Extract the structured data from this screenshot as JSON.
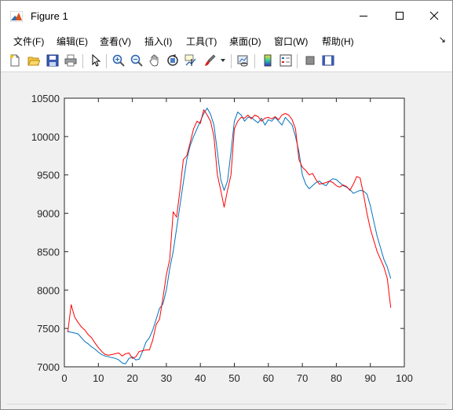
{
  "window": {
    "title": "Figure 1",
    "controls": {
      "minimize": "minimize",
      "maximize": "maximize",
      "close": "close"
    }
  },
  "menu": {
    "items": [
      "文件(F)",
      "编辑(E)",
      "查看(V)",
      "插入(I)",
      "工具(T)",
      "桌面(D)",
      "窗口(W)",
      "帮助(H)"
    ]
  },
  "toolbar": {
    "icons": [
      "new-figure-icon",
      "open-file-icon",
      "save-icon",
      "print-icon",
      "select-arrow-icon",
      "zoom-in-icon",
      "zoom-out-icon",
      "pan-hand-icon",
      "rotate-3d-icon",
      "data-cursor-icon",
      "brush-icon",
      "brush-dropdown-icon",
      "link-plot-icon",
      "colorbar-icon",
      "legend-icon",
      "hide-plot-tools-icon",
      "show-plot-tools-icon"
    ]
  },
  "colors": {
    "series1": "#0072BD",
    "series2": "#FF0000",
    "axes_background": "#ffffff",
    "figure_background": "#f0f0f0"
  },
  "chart_data": {
    "type": "line",
    "title": "",
    "xlabel": "",
    "ylabel": "",
    "xlim": [
      0,
      100
    ],
    "ylim": [
      7000,
      10500
    ],
    "xticks": [
      0,
      10,
      20,
      30,
      40,
      50,
      60,
      70,
      80,
      90,
      100
    ],
    "yticks": [
      7000,
      7500,
      8000,
      8500,
      9000,
      9500,
      10000,
      10500
    ],
    "grid": false,
    "legend": "none",
    "series": [
      {
        "color": "#0072BD",
        "x": [
          1,
          2,
          3,
          4,
          5,
          6,
          7,
          8,
          9,
          10,
          11,
          12,
          13,
          14,
          15,
          16,
          17,
          18,
          19,
          20,
          21,
          22,
          23,
          24,
          25,
          26,
          27,
          28,
          29,
          30,
          31,
          32,
          33,
          34,
          35,
          36,
          37,
          38,
          39,
          40,
          41,
          42,
          43,
          44,
          45,
          46,
          47,
          48,
          49,
          50,
          51,
          52,
          53,
          54,
          55,
          56,
          57,
          58,
          59,
          60,
          61,
          62,
          63,
          64,
          65,
          66,
          67,
          68,
          69,
          70,
          71,
          72,
          73,
          74,
          75,
          76,
          77,
          78,
          79,
          80,
          81,
          82,
          83,
          84,
          85,
          86,
          87,
          88,
          89,
          90,
          91,
          92,
          93,
          94,
          95,
          96
        ],
        "y": [
          7460,
          7450,
          7440,
          7430,
          7380,
          7330,
          7300,
          7260,
          7230,
          7190,
          7160,
          7140,
          7130,
          7120,
          7110,
          7090,
          7050,
          7040,
          7110,
          7130,
          7090,
          7100,
          7200,
          7320,
          7380,
          7480,
          7620,
          7760,
          7820,
          8000,
          8280,
          8500,
          8800,
          9100,
          9400,
          9700,
          9880,
          10000,
          10100,
          10200,
          10300,
          10370,
          10290,
          10150,
          9800,
          9440,
          9300,
          9420,
          9800,
          10200,
          10320,
          10280,
          10200,
          10250,
          10250,
          10210,
          10180,
          10240,
          10150,
          10220,
          10200,
          10250,
          10200,
          10150,
          10250,
          10200,
          10150,
          10000,
          9800,
          9500,
          9380,
          9320,
          9360,
          9400,
          9420,
          9380,
          9360,
          9420,
          9450,
          9440,
          9400,
          9360,
          9340,
          9310,
          9260,
          9280,
          9300,
          9290,
          9250,
          9100,
          8900,
          8700,
          8550,
          8400,
          8300,
          8150
        ]
      },
      {
        "color": "#FF0000",
        "x": [
          1,
          2,
          3,
          4,
          5,
          6,
          7,
          8,
          9,
          10,
          11,
          12,
          13,
          14,
          15,
          16,
          17,
          18,
          19,
          20,
          21,
          22,
          23,
          24,
          25,
          26,
          27,
          28,
          29,
          30,
          31,
          32,
          33,
          34,
          35,
          36,
          37,
          38,
          39,
          40,
          41,
          42,
          43,
          44,
          45,
          46,
          47,
          48,
          49,
          50,
          51,
          52,
          53,
          54,
          55,
          56,
          57,
          58,
          59,
          60,
          61,
          62,
          63,
          64,
          65,
          66,
          67,
          68,
          69,
          70,
          71,
          72,
          73,
          74,
          75,
          76,
          77,
          78,
          79,
          80,
          81,
          82,
          83,
          84,
          85,
          86,
          87,
          88,
          89,
          90,
          91,
          92,
          93,
          94,
          95,
          96
        ],
        "y": [
          7450,
          7810,
          7650,
          7580,
          7520,
          7480,
          7420,
          7380,
          7310,
          7250,
          7200,
          7160,
          7150,
          7160,
          7170,
          7180,
          7140,
          7170,
          7180,
          7110,
          7130,
          7200,
          7210,
          7220,
          7220,
          7350,
          7550,
          7620,
          7900,
          8200,
          8400,
          9020,
          8950,
          9300,
          9700,
          9750,
          9920,
          10100,
          10200,
          10170,
          10350,
          10280,
          10200,
          10000,
          9500,
          9300,
          9080,
          9300,
          9500,
          10100,
          10200,
          10250,
          10240,
          10280,
          10230,
          10280,
          10260,
          10200,
          10240,
          10250,
          10230,
          10260,
          10220,
          10280,
          10300,
          10280,
          10220,
          10100,
          9700,
          9600,
          9560,
          9500,
          9520,
          9440,
          9380,
          9390,
          9400,
          9420,
          9400,
          9360,
          9340,
          9370,
          9350,
          9300,
          9380,
          9480,
          9460,
          9250,
          9000,
          8800,
          8650,
          8500,
          8400,
          8300,
          8150,
          7770
        ]
      }
    ]
  }
}
